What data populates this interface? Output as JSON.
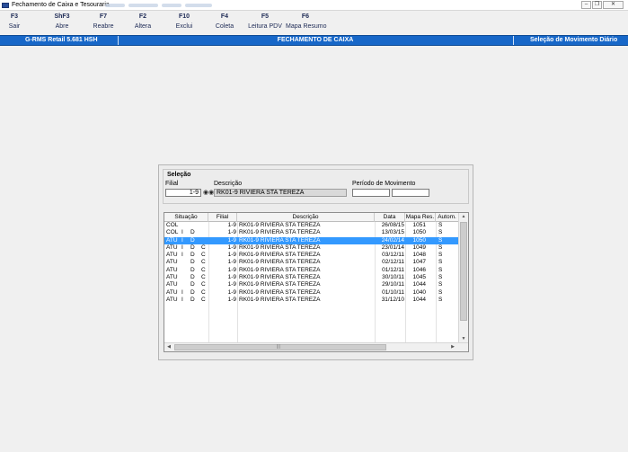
{
  "window": {
    "title": "Fechamento de Caixa e Tesouraria",
    "controls": [
      "minimize-icon",
      "restore-icon",
      "close-icon"
    ]
  },
  "toolbar": [
    {
      "key": "F3",
      "label": "Sair"
    },
    {
      "key": "ShF3",
      "label": "Abre"
    },
    {
      "key": "F7",
      "label": "Reabre"
    },
    {
      "key": "F2",
      "label": "Altera"
    },
    {
      "key": "F10",
      "label": "Exclui"
    },
    {
      "key": "F4",
      "label": "Coleta"
    },
    {
      "key": "F5",
      "label": "Leitura PDV"
    },
    {
      "key": "F6",
      "label": "Mapa Resumo"
    }
  ],
  "header": {
    "left": "G-RMS Retail 5.681 HSH",
    "center": "FECHAMENTO DE CAIXA",
    "right": "Seleção de Movimento Diário",
    "color": "#1767c8"
  },
  "selecao": {
    "title": "Seleção",
    "filial_label": "Filial",
    "filial_value": "1-9",
    "descricao_label": "Descrição",
    "descricao_value": "RK01-9 RIVIERA STA TEREZA",
    "periodo_label": "Período de Movimento",
    "periodo_from": "",
    "periodo_to": ""
  },
  "grid": {
    "headers": {
      "situacao": "Situação",
      "filial": "Filial",
      "descricao": "Descrição",
      "data": "Data",
      "mapa": "Mapa Res.",
      "autom": "Autom."
    },
    "rows": [
      {
        "s1": "COL",
        "s2": "",
        "s3": "",
        "s4": "",
        "filial": "",
        "descricao": "RK01-9 RIVIERA STA TEREZA",
        "data": "26/08/15",
        "mapa": "1051",
        "autom": "S",
        "selected": false
      },
      {
        "s1": "COL",
        "s2": "I",
        "s3": "D",
        "s4": "",
        "filial": "",
        "descricao": "RK01-9 RIVIERA STA TEREZA",
        "data": "13/03/15",
        "mapa": "1050",
        "autom": "S",
        "selected": false
      },
      {
        "s1": "ATU",
        "s2": "I",
        "s3": "D",
        "s4": "",
        "filial": "",
        "descricao": "RK01-9 RIVIERA STA TEREZA",
        "data": "24/02/14",
        "mapa": "1050",
        "autom": "S",
        "selected": true
      },
      {
        "s1": "ATU",
        "s2": "I",
        "s3": "D",
        "s4": "C",
        "filial": "",
        "descricao": "RK01-9 RIVIERA STA TEREZA",
        "data": "23/01/14",
        "mapa": "1049",
        "autom": "S",
        "selected": false
      },
      {
        "s1": "ATU",
        "s2": "I",
        "s3": "D",
        "s4": "C",
        "filial": "",
        "descricao": "RK01-9 RIVIERA STA TEREZA",
        "data": "03/12/11",
        "mapa": "1048",
        "autom": "S",
        "selected": false
      },
      {
        "s1": "ATU",
        "s2": "",
        "s3": "D",
        "s4": "C",
        "filial": "",
        "descricao": "RK01-9 RIVIERA STA TEREZA",
        "data": "02/12/11",
        "mapa": "1047",
        "autom": "S",
        "selected": false
      },
      {
        "s1": "ATU",
        "s2": "",
        "s3": "D",
        "s4": "C",
        "filial": "",
        "descricao": "RK01-9 RIVIERA STA TEREZA",
        "data": "01/12/11",
        "mapa": "1046",
        "autom": "S",
        "selected": false
      },
      {
        "s1": "ATU",
        "s2": "",
        "s3": "D",
        "s4": "C",
        "filial": "",
        "descricao": "RK01-9 RIVIERA STA TEREZA",
        "data": "30/10/11",
        "mapa": "1045",
        "autom": "S",
        "selected": false
      },
      {
        "s1": "ATU",
        "s2": "",
        "s3": "D",
        "s4": "C",
        "filial": "",
        "descricao": "RK01-9 RIVIERA STA TEREZA",
        "data": "29/10/11",
        "mapa": "1044",
        "autom": "S",
        "selected": false
      },
      {
        "s1": "ATU",
        "s2": "I",
        "s3": "D",
        "s4": "C",
        "filial": "",
        "descricao": "RK01-9 RIVIERA STA TEREZA",
        "data": "01/10/11",
        "mapa": "1040",
        "autom": "S",
        "selected": false
      },
      {
        "s1": "ATU",
        "s2": "I",
        "s3": "D",
        "s4": "C",
        "filial": "",
        "descricao": "RK01-9 RIVIERA STA TEREZA",
        "data": "31/12/10",
        "mapa": "1044",
        "autom": "S",
        "selected": false
      }
    ]
  }
}
